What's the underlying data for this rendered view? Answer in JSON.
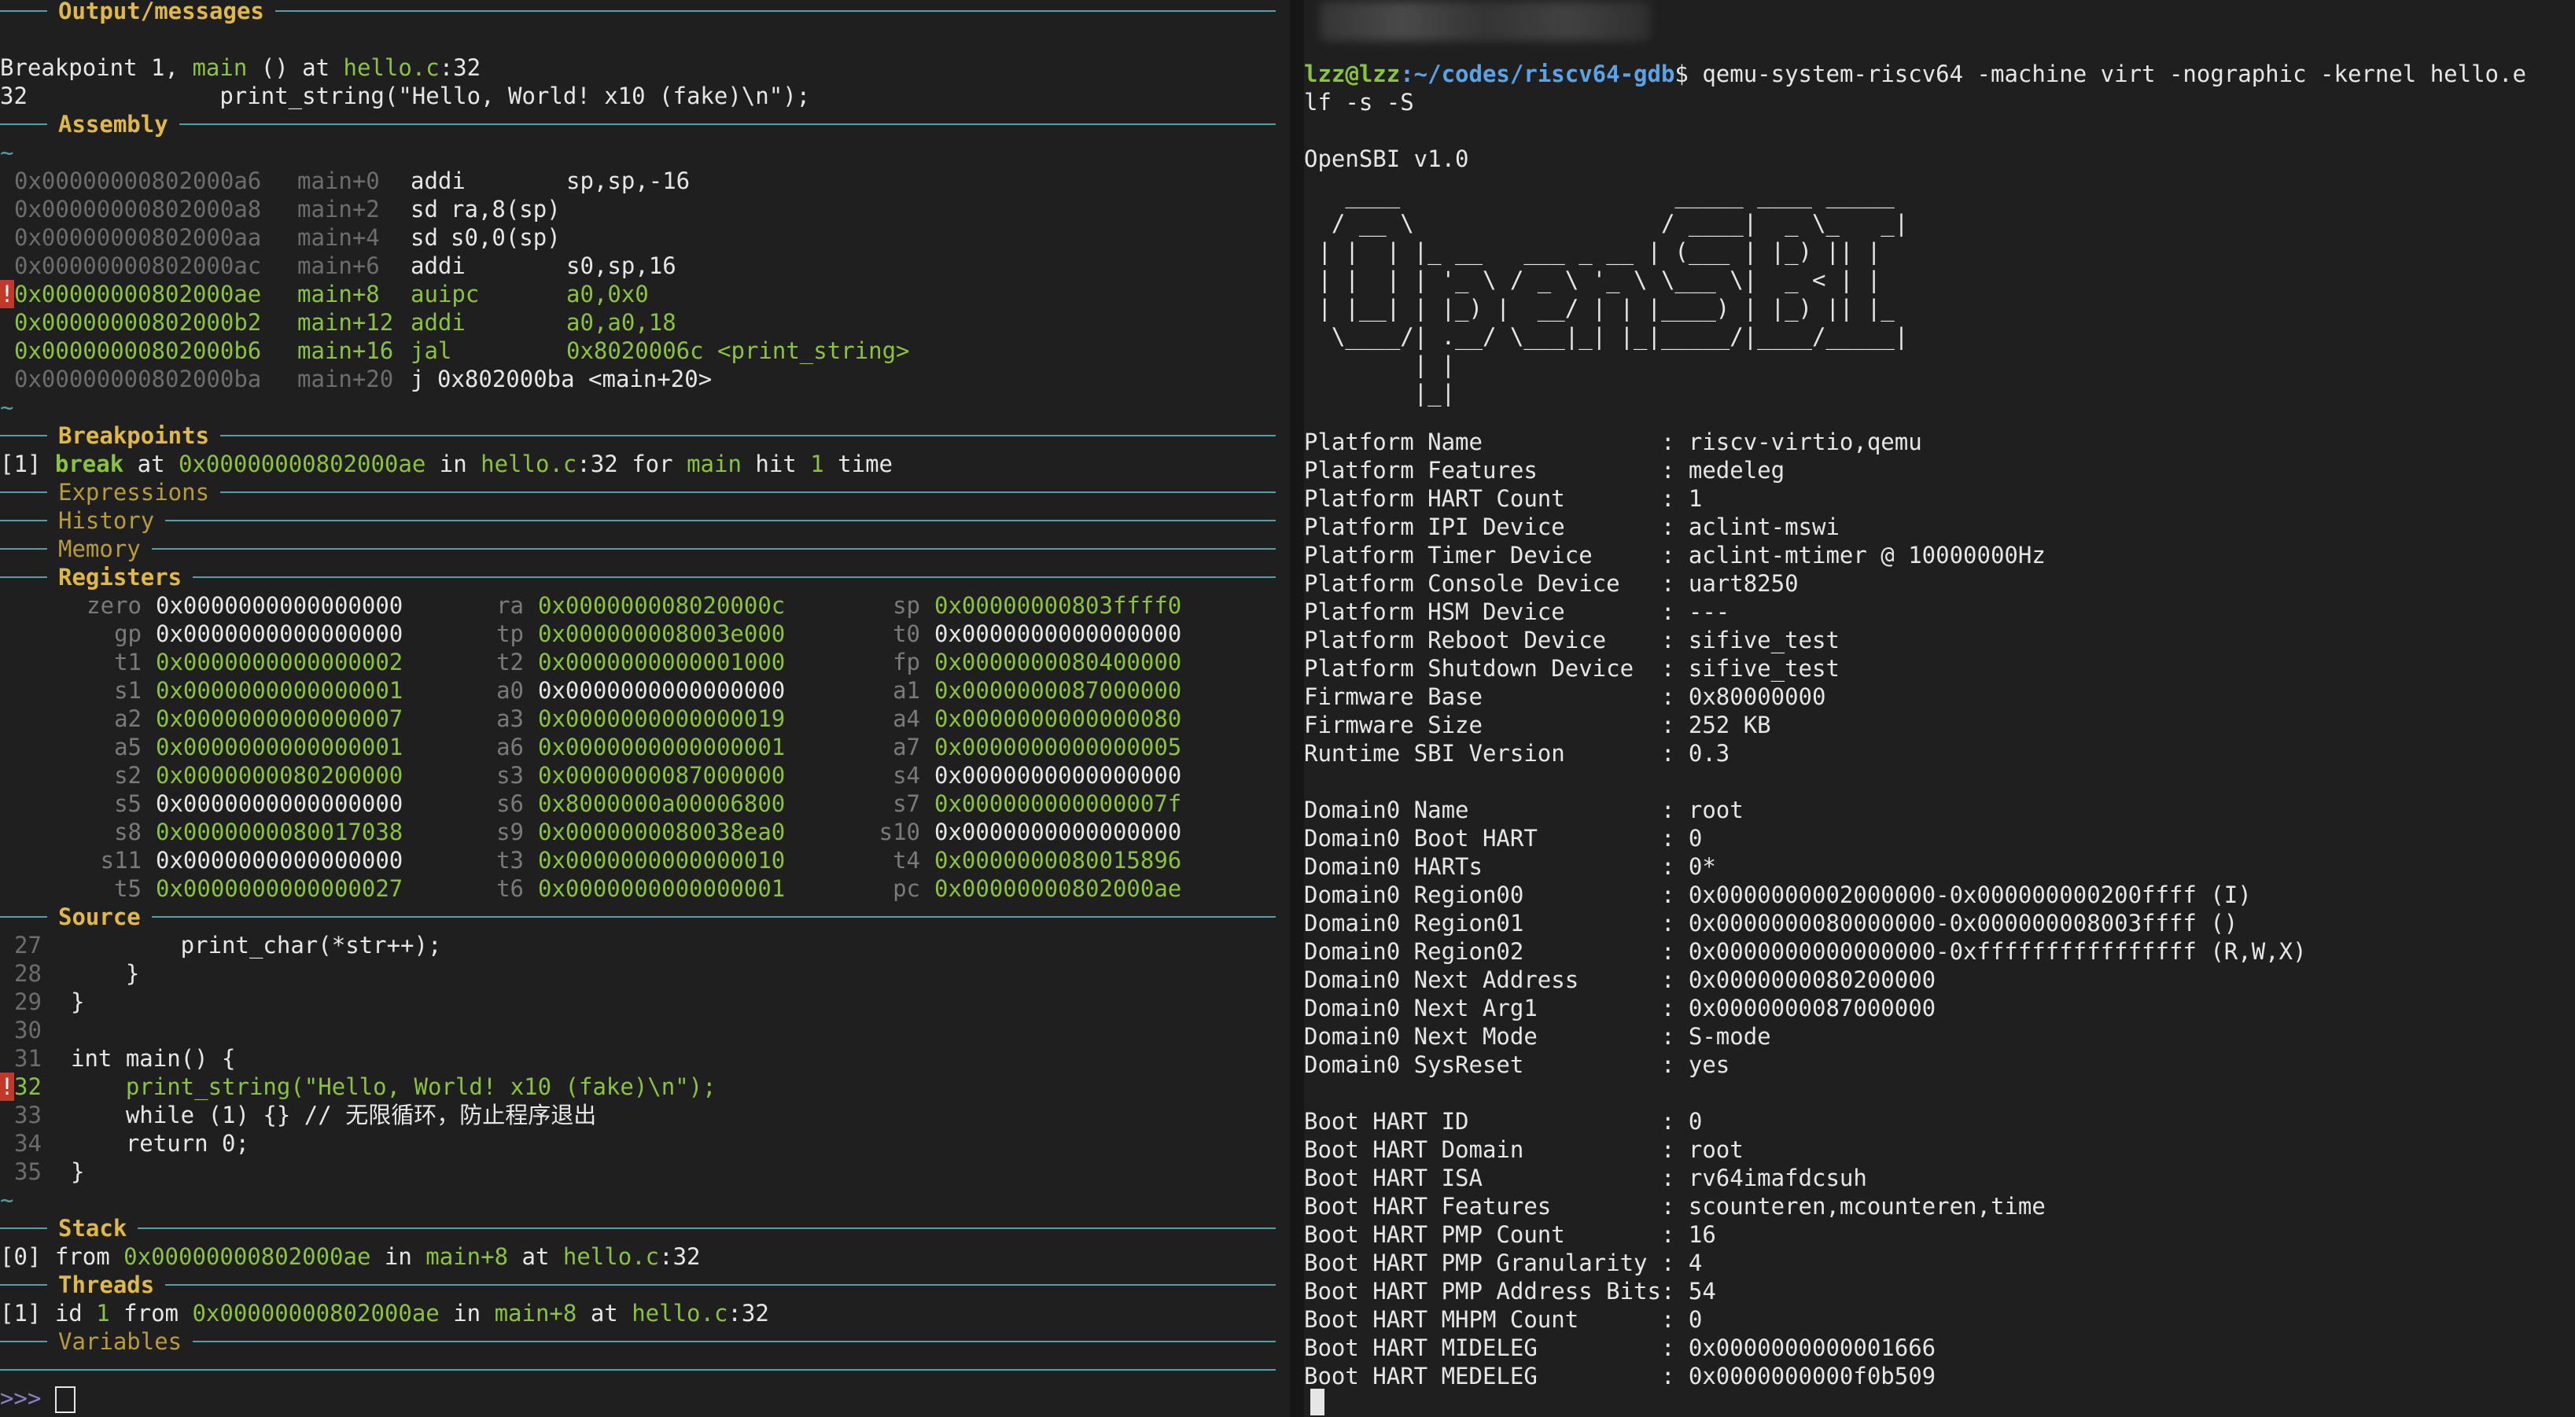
{
  "gdb": {
    "sections": {
      "output": "Output/messages",
      "assembly": "Assembly",
      "breakpoints": "Breakpoints",
      "expressions": "Expressions",
      "history": "History",
      "memory": "Memory",
      "registers": "Registers",
      "source": "Source",
      "stack": "Stack",
      "threads": "Threads",
      "variables": "Variables"
    },
    "output": {
      "line1_prefix": "Breakpoint 1, ",
      "line1_func": "main",
      "line1_mid": " () at ",
      "line1_file": "hello.c",
      "line1_suffix": ":32",
      "line2": "32              print_string(\"Hello, World! x10 (fake)\\n\");"
    },
    "assembly": [
      {
        "addr": "0x00000000802000a6",
        "off": "main+0",
        "op": "addi",
        "args": "sp,sp,-16",
        "state": "past"
      },
      {
        "addr": "0x00000000802000a8",
        "off": "main+2",
        "op": "sd",
        "args": "ra,8(sp)",
        "state": "past"
      },
      {
        "addr": "0x00000000802000aa",
        "off": "main+4",
        "op": "sd",
        "args": "s0,0(sp)",
        "state": "past"
      },
      {
        "addr": "0x00000000802000ac",
        "off": "main+6",
        "op": "addi",
        "args": "s0,sp,16",
        "state": "past"
      },
      {
        "addr": "0x00000000802000ae",
        "off": "main+8",
        "op": "auipc",
        "args": "a0,0x0",
        "state": "current"
      },
      {
        "addr": "0x00000000802000b2",
        "off": "main+12",
        "op": "addi",
        "args": "a0,a0,18",
        "state": "next"
      },
      {
        "addr": "0x00000000802000b6",
        "off": "main+16",
        "op": "jal",
        "args": "0x8020006c <print_string>",
        "state": "next"
      },
      {
        "addr": "0x00000000802000ba",
        "off": "main+20",
        "op": "j",
        "args": "0x802000ba <main+20>",
        "state": "past"
      }
    ],
    "breakpoint": {
      "idx": "[1]",
      "kw": "break",
      "at": " at ",
      "addr": "0x00000000802000ae",
      "in": " in ",
      "file": "hello.c",
      "line": ":32",
      "for": " for ",
      "func": "main",
      "hit": " hit ",
      "count": "1",
      "time": " time"
    },
    "registers": [
      [
        {
          "n": "zero",
          "v": "0x0000000000000000",
          "c": false
        },
        {
          "n": "ra",
          "v": "0x000000008020000c",
          "c": true
        },
        {
          "n": "sp",
          "v": "0x00000000803ffff0",
          "c": true
        }
      ],
      [
        {
          "n": "gp",
          "v": "0x0000000000000000",
          "c": false
        },
        {
          "n": "tp",
          "v": "0x000000008003e000",
          "c": true
        },
        {
          "n": "t0",
          "v": "0x0000000000000000",
          "c": false
        }
      ],
      [
        {
          "n": "t1",
          "v": "0x0000000000000002",
          "c": true
        },
        {
          "n": "t2",
          "v": "0x0000000000001000",
          "c": true
        },
        {
          "n": "fp",
          "v": "0x0000000080400000",
          "c": true
        }
      ],
      [
        {
          "n": "s1",
          "v": "0x0000000000000001",
          "c": true
        },
        {
          "n": "a0",
          "v": "0x0000000000000000",
          "c": false
        },
        {
          "n": "a1",
          "v": "0x0000000087000000",
          "c": true
        }
      ],
      [
        {
          "n": "a2",
          "v": "0x0000000000000007",
          "c": true
        },
        {
          "n": "a3",
          "v": "0x0000000000000019",
          "c": true
        },
        {
          "n": "a4",
          "v": "0x0000000000000080",
          "c": true
        }
      ],
      [
        {
          "n": "a5",
          "v": "0x0000000000000001",
          "c": true
        },
        {
          "n": "a6",
          "v": "0x0000000000000001",
          "c": true
        },
        {
          "n": "a7",
          "v": "0x0000000000000005",
          "c": true
        }
      ],
      [
        {
          "n": "s2",
          "v": "0x0000000080200000",
          "c": true
        },
        {
          "n": "s3",
          "v": "0x0000000087000000",
          "c": true
        },
        {
          "n": "s4",
          "v": "0x0000000000000000",
          "c": false
        }
      ],
      [
        {
          "n": "s5",
          "v": "0x0000000000000000",
          "c": false
        },
        {
          "n": "s6",
          "v": "0x8000000a00006800",
          "c": true
        },
        {
          "n": "s7",
          "v": "0x000000000000007f",
          "c": true
        }
      ],
      [
        {
          "n": "s8",
          "v": "0x0000000080017038",
          "c": true
        },
        {
          "n": "s9",
          "v": "0x0000000080038ea0",
          "c": true
        },
        {
          "n": "s10",
          "v": "0x0000000000000000",
          "c": false
        }
      ],
      [
        {
          "n": "s11",
          "v": "0x0000000000000000",
          "c": false
        },
        {
          "n": "t3",
          "v": "0x0000000000000010",
          "c": true
        },
        {
          "n": "t4",
          "v": "0x0000000080015896",
          "c": true
        }
      ],
      [
        {
          "n": "t5",
          "v": "0x0000000000000027",
          "c": true
        },
        {
          "n": "t6",
          "v": "0x0000000000000001",
          "c": true
        },
        {
          "n": "pc",
          "v": "0x00000000802000ae",
          "c": true
        }
      ]
    ],
    "source": [
      {
        "n": "27",
        "code": "        print_char(*str++);",
        "cur": false
      },
      {
        "n": "28",
        "code": "    }",
        "cur": false
      },
      {
        "n": "29",
        "code": "}",
        "cur": false
      },
      {
        "n": "30",
        "code": "",
        "cur": false
      },
      {
        "n": "31",
        "code": "int main() {",
        "cur": false
      },
      {
        "n": "32",
        "code": "    print_string(\"Hello, World! x10 (fake)\\n\");",
        "cur": true
      },
      {
        "n": "33",
        "code": "    while (1) {} // 无限循环，防止程序退出",
        "cur": false
      },
      {
        "n": "34",
        "code": "    return 0;",
        "cur": false
      },
      {
        "n": "35",
        "code": "}",
        "cur": false
      }
    ],
    "stack": {
      "idx": "[0]",
      "from": " from ",
      "addr": "0x00000000802000ae",
      "in": " in ",
      "func": "main+8",
      "at": " at ",
      "file": "hello.c",
      "line": ":32"
    },
    "threads": {
      "idx": "[1]",
      "id": " id ",
      "num": "1",
      "from": " from ",
      "addr": "0x00000000802000ae",
      "in": " in ",
      "func": "main+8",
      "at": " at ",
      "file": "hello.c",
      "line": ":32"
    },
    "prompt": ">>>"
  },
  "terminal": {
    "prompt_user": "lzz@lzz",
    "prompt_path": ":~/codes/riscv64-gdb",
    "prompt_dollar": "$ ",
    "command_line1": "qemu-system-riscv64 -machine virt -nographic -kernel hello.e",
    "command_line2": "lf -s -S",
    "opensbi_version": "OpenSBI v1.0",
    "banner": [
      "   ____                    _____ ____ _____",
      "  / __ \\                  / ____|  _ \\_   _|",
      " | |  | |_ __   ___ _ __ | (___ | |_) || |",
      " | |  | | '_ \\ / _ \\ '_ \\ \\___ \\|  _ < | |",
      " | |__| | |_) |  __/ | | |____) | |_) || |_",
      "  \\____/| .__/ \\___|_| |_|_____/|____/_____|",
      "        | |",
      "        |_|"
    ],
    "platform": [
      "Platform Name             : riscv-virtio,qemu",
      "Platform Features         : medeleg",
      "Platform HART Count       : 1",
      "Platform IPI Device       : aclint-mswi",
      "Platform Timer Device     : aclint-mtimer @ 10000000Hz",
      "Platform Console Device   : uart8250",
      "Platform HSM Device       : ---",
      "Platform Reboot Device    : sifive_test",
      "Platform Shutdown Device  : sifive_test",
      "Firmware Base             : 0x80000000",
      "Firmware Size             : 252 KB",
      "Runtime SBI Version       : 0.3"
    ],
    "domain": [
      "Domain0 Name              : root",
      "Domain0 Boot HART         : 0",
      "Domain0 HARTs             : 0*",
      "Domain0 Region00          : 0x0000000002000000-0x000000000200ffff (I)",
      "Domain0 Region01          : 0x0000000080000000-0x000000008003ffff ()",
      "Domain0 Region02          : 0x0000000000000000-0xffffffffffffffff (R,W,X)",
      "Domain0 Next Address      : 0x0000000080200000",
      "Domain0 Next Arg1         : 0x0000000087000000",
      "Domain0 Next Mode         : S-mode",
      "Domain0 SysReset          : yes"
    ],
    "boot": [
      "Boot HART ID              : 0",
      "Boot HART Domain          : root",
      "Boot HART ISA             : rv64imafdcsuh",
      "Boot HART Features        : scounteren,mcounteren,time",
      "Boot HART PMP Count       : 16",
      "Boot HART PMP Granularity : 4",
      "Boot HART PMP Address Bits: 54",
      "Boot HART MHPM Count      : 0",
      "Boot HART MIDELEG         : 0x0000000000001666",
      "Boot HART MEDELEG         : 0x0000000000f0b509"
    ]
  }
}
